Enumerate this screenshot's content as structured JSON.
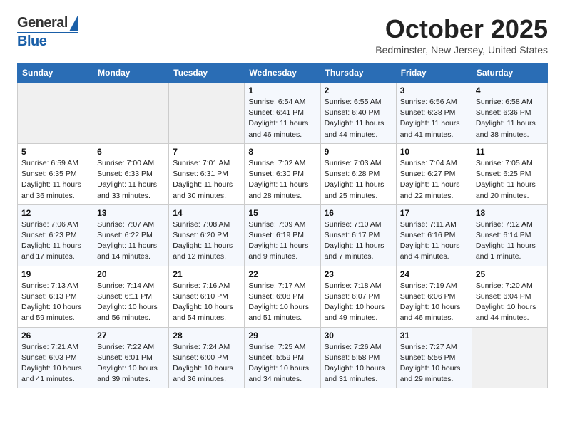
{
  "header": {
    "logo_general": "General",
    "logo_blue": "Blue",
    "month_year": "October 2025",
    "location": "Bedminster, New Jersey, United States"
  },
  "days_of_week": [
    "Sunday",
    "Monday",
    "Tuesday",
    "Wednesday",
    "Thursday",
    "Friday",
    "Saturday"
  ],
  "weeks": [
    {
      "cells": [
        {
          "day": "",
          "info": ""
        },
        {
          "day": "",
          "info": ""
        },
        {
          "day": "",
          "info": ""
        },
        {
          "day": "1",
          "info": "Sunrise: 6:54 AM\nSunset: 6:41 PM\nDaylight: 11 hours\nand 46 minutes."
        },
        {
          "day": "2",
          "info": "Sunrise: 6:55 AM\nSunset: 6:40 PM\nDaylight: 11 hours\nand 44 minutes."
        },
        {
          "day": "3",
          "info": "Sunrise: 6:56 AM\nSunset: 6:38 PM\nDaylight: 11 hours\nand 41 minutes."
        },
        {
          "day": "4",
          "info": "Sunrise: 6:58 AM\nSunset: 6:36 PM\nDaylight: 11 hours\nand 38 minutes."
        }
      ]
    },
    {
      "cells": [
        {
          "day": "5",
          "info": "Sunrise: 6:59 AM\nSunset: 6:35 PM\nDaylight: 11 hours\nand 36 minutes."
        },
        {
          "day": "6",
          "info": "Sunrise: 7:00 AM\nSunset: 6:33 PM\nDaylight: 11 hours\nand 33 minutes."
        },
        {
          "day": "7",
          "info": "Sunrise: 7:01 AM\nSunset: 6:31 PM\nDaylight: 11 hours\nand 30 minutes."
        },
        {
          "day": "8",
          "info": "Sunrise: 7:02 AM\nSunset: 6:30 PM\nDaylight: 11 hours\nand 28 minutes."
        },
        {
          "day": "9",
          "info": "Sunrise: 7:03 AM\nSunset: 6:28 PM\nDaylight: 11 hours\nand 25 minutes."
        },
        {
          "day": "10",
          "info": "Sunrise: 7:04 AM\nSunset: 6:27 PM\nDaylight: 11 hours\nand 22 minutes."
        },
        {
          "day": "11",
          "info": "Sunrise: 7:05 AM\nSunset: 6:25 PM\nDaylight: 11 hours\nand 20 minutes."
        }
      ]
    },
    {
      "cells": [
        {
          "day": "12",
          "info": "Sunrise: 7:06 AM\nSunset: 6:23 PM\nDaylight: 11 hours\nand 17 minutes."
        },
        {
          "day": "13",
          "info": "Sunrise: 7:07 AM\nSunset: 6:22 PM\nDaylight: 11 hours\nand 14 minutes."
        },
        {
          "day": "14",
          "info": "Sunrise: 7:08 AM\nSunset: 6:20 PM\nDaylight: 11 hours\nand 12 minutes."
        },
        {
          "day": "15",
          "info": "Sunrise: 7:09 AM\nSunset: 6:19 PM\nDaylight: 11 hours\nand 9 minutes."
        },
        {
          "day": "16",
          "info": "Sunrise: 7:10 AM\nSunset: 6:17 PM\nDaylight: 11 hours\nand 7 minutes."
        },
        {
          "day": "17",
          "info": "Sunrise: 7:11 AM\nSunset: 6:16 PM\nDaylight: 11 hours\nand 4 minutes."
        },
        {
          "day": "18",
          "info": "Sunrise: 7:12 AM\nSunset: 6:14 PM\nDaylight: 11 hours\nand 1 minute."
        }
      ]
    },
    {
      "cells": [
        {
          "day": "19",
          "info": "Sunrise: 7:13 AM\nSunset: 6:13 PM\nDaylight: 10 hours\nand 59 minutes."
        },
        {
          "day": "20",
          "info": "Sunrise: 7:14 AM\nSunset: 6:11 PM\nDaylight: 10 hours\nand 56 minutes."
        },
        {
          "day": "21",
          "info": "Sunrise: 7:16 AM\nSunset: 6:10 PM\nDaylight: 10 hours\nand 54 minutes."
        },
        {
          "day": "22",
          "info": "Sunrise: 7:17 AM\nSunset: 6:08 PM\nDaylight: 10 hours\nand 51 minutes."
        },
        {
          "day": "23",
          "info": "Sunrise: 7:18 AM\nSunset: 6:07 PM\nDaylight: 10 hours\nand 49 minutes."
        },
        {
          "day": "24",
          "info": "Sunrise: 7:19 AM\nSunset: 6:06 PM\nDaylight: 10 hours\nand 46 minutes."
        },
        {
          "day": "25",
          "info": "Sunrise: 7:20 AM\nSunset: 6:04 PM\nDaylight: 10 hours\nand 44 minutes."
        }
      ]
    },
    {
      "cells": [
        {
          "day": "26",
          "info": "Sunrise: 7:21 AM\nSunset: 6:03 PM\nDaylight: 10 hours\nand 41 minutes."
        },
        {
          "day": "27",
          "info": "Sunrise: 7:22 AM\nSunset: 6:01 PM\nDaylight: 10 hours\nand 39 minutes."
        },
        {
          "day": "28",
          "info": "Sunrise: 7:24 AM\nSunset: 6:00 PM\nDaylight: 10 hours\nand 36 minutes."
        },
        {
          "day": "29",
          "info": "Sunrise: 7:25 AM\nSunset: 5:59 PM\nDaylight: 10 hours\nand 34 minutes."
        },
        {
          "day": "30",
          "info": "Sunrise: 7:26 AM\nSunset: 5:58 PM\nDaylight: 10 hours\nand 31 minutes."
        },
        {
          "day": "31",
          "info": "Sunrise: 7:27 AM\nSunset: 5:56 PM\nDaylight: 10 hours\nand 29 minutes."
        },
        {
          "day": "",
          "info": ""
        }
      ]
    }
  ]
}
